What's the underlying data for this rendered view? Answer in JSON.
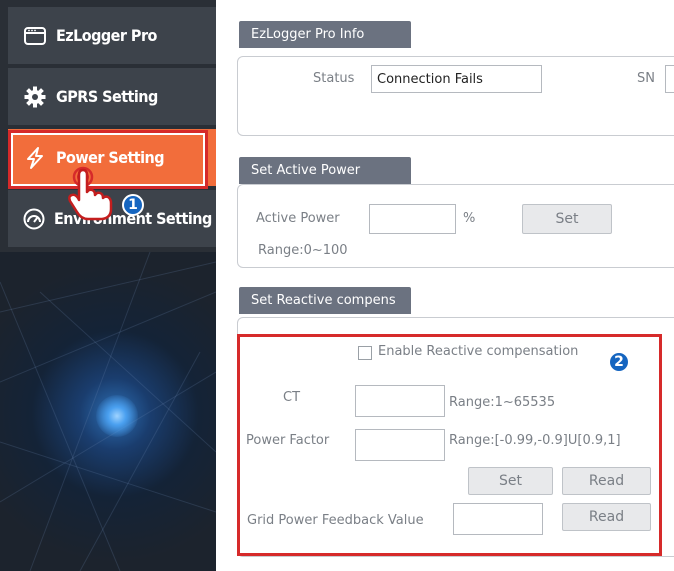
{
  "sidebar": {
    "items": [
      {
        "label": "EzLogger Pro",
        "icon": "window-icon"
      },
      {
        "label": "GPRS Setting",
        "icon": "gear-icon"
      },
      {
        "label": "Power Setting",
        "icon": "lightning-icon",
        "active": true
      },
      {
        "label": "Environment Setting",
        "icon": "gauge-icon"
      }
    ]
  },
  "markers": {
    "one": "1",
    "two": "2"
  },
  "info": {
    "title": "EzLogger Pro Info",
    "status_label": "Status",
    "status_value": "Connection Fails",
    "sn_label": "SN"
  },
  "active_power": {
    "title": "Set Active Power",
    "label": "Active Power",
    "unit": "%",
    "set_button": "Set",
    "range": "Range:0~100"
  },
  "reactive": {
    "title": "Set Reactive compens",
    "enable_label": "Enable Reactive compensation",
    "ct_label": "CT",
    "ct_range": "Range:1~65535",
    "pf_label": "Power Factor",
    "pf_range": "Range:[-0.99,-0.9]U[0.9,1]",
    "set_button": "Set",
    "read_button": "Read",
    "grid_label": "Grid Power Feedback Value",
    "grid_read_button": "Read"
  },
  "colors": {
    "accent": "#f26d3b",
    "highlight": "#d62a2a",
    "marker": "#1565c0",
    "section": "#6b7280"
  }
}
